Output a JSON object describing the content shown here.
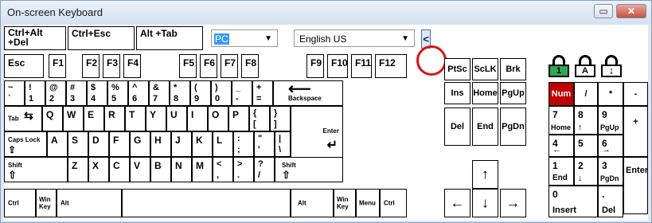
{
  "window": {
    "title": "On-screen Keyboard"
  },
  "top": {
    "ctrl_alt_del": "Ctrl+Alt\n+Del",
    "ctrl_esc": "Ctrl+Esc",
    "alt_tab": "Alt +Tab",
    "layout_value": "PC",
    "language_value": "English US",
    "collapse_symbol": "<"
  },
  "keys": {
    "esc": "Esc",
    "f1": "F1",
    "f2": "F2",
    "f3": "F3",
    "f4": "F4",
    "f5": "F5",
    "f6": "F6",
    "f7": "F7",
    "f8": "F8",
    "f9": "F9",
    "f10": "F10",
    "f11": "F11",
    "f12": "F12",
    "prtsc": "PtSc",
    "sclk": "ScLK",
    "brk": "Brk",
    "tilde_t": "~",
    "tilde_b": "`",
    "n1_t": "!",
    "n1_b": "1",
    "n2_t": "@",
    "n2_b": "2",
    "n3_t": "#",
    "n3_b": "3",
    "n4_t": "$",
    "n4_b": "4",
    "n5_t": "%",
    "n5_b": "5",
    "n6_t": "^",
    "n6_b": "6",
    "n7_t": "&",
    "n7_b": "7",
    "n8_t": "*",
    "n8_b": "8",
    "n9_t": "(",
    "n9_b": "9",
    "n0_t": ")",
    "n0_b": "0",
    "minus_t": "_",
    "minus_b": "-",
    "plus_t": "+",
    "plus_b": "=",
    "backspace": "Backspace",
    "ins": "Ins",
    "home": "Home",
    "pgup": "PgUp",
    "num": "Num",
    "np_div": "/",
    "np_mul": "*",
    "np_minus": "-",
    "tab": "Tab",
    "q": "Q",
    "w": "W",
    "e": "E",
    "r": "R",
    "t": "T",
    "y": "Y",
    "u": "U",
    "i": "I",
    "o": "O",
    "p": "P",
    "lb_t": "{",
    "lb_b": "[",
    "rb_t": "}",
    "rb_b": "]",
    "enter": "Enter",
    "del": "Del",
    "end": "End",
    "pgdn": "PgDn",
    "np7": "7",
    "np7_s": "Home",
    "np8": "8",
    "np9": "9",
    "np9_s": "PgUp",
    "np_plus": "+",
    "caps": "Caps Lock",
    "a": "A",
    "s": "S",
    "d": "D",
    "f": "F",
    "g": "G",
    "h": "H",
    "j": "J",
    "k": "K",
    "l": "L",
    "semi_t": ":",
    "semi_b": ";",
    "quote_t": "\"",
    "quote_b": "'",
    "pipe_t": "|",
    "pipe_b": "\\",
    "np4": "4",
    "np5": "5",
    "np6": "6",
    "shift": "Shift",
    "z": "Z",
    "x": "X",
    "c": "C",
    "v": "V",
    "b": "B",
    "n": "N",
    "m": "M",
    "comma_t": "<",
    "comma_b": ",",
    "dot_t": ">",
    "dot_b": ".",
    "slash_t": "?",
    "slash_b": "/",
    "rshift": "Shift",
    "np1": "1",
    "np1_s": "End",
    "np2": "2",
    "np3": "3",
    "np3_s": "PgDn",
    "np_enter": "Enter",
    "ctrl": "Ctrl",
    "win": "Win\nKey",
    "alt": "Alt",
    "ralt": "Alt",
    "rwin": "Win\nKey",
    "menu": "Menu",
    "rctrl": "Ctrl",
    "np0": "0",
    "np0_s": "Insert",
    "npdot": ".",
    "npdot_s": "Del"
  },
  "locks": {
    "num": "1",
    "caps": "A",
    "scroll": "↨"
  },
  "colors": {
    "num_key_bg": "#c00000",
    "num_lock_fill": "#2fa84f",
    "highlight_circle": "#e01010"
  }
}
